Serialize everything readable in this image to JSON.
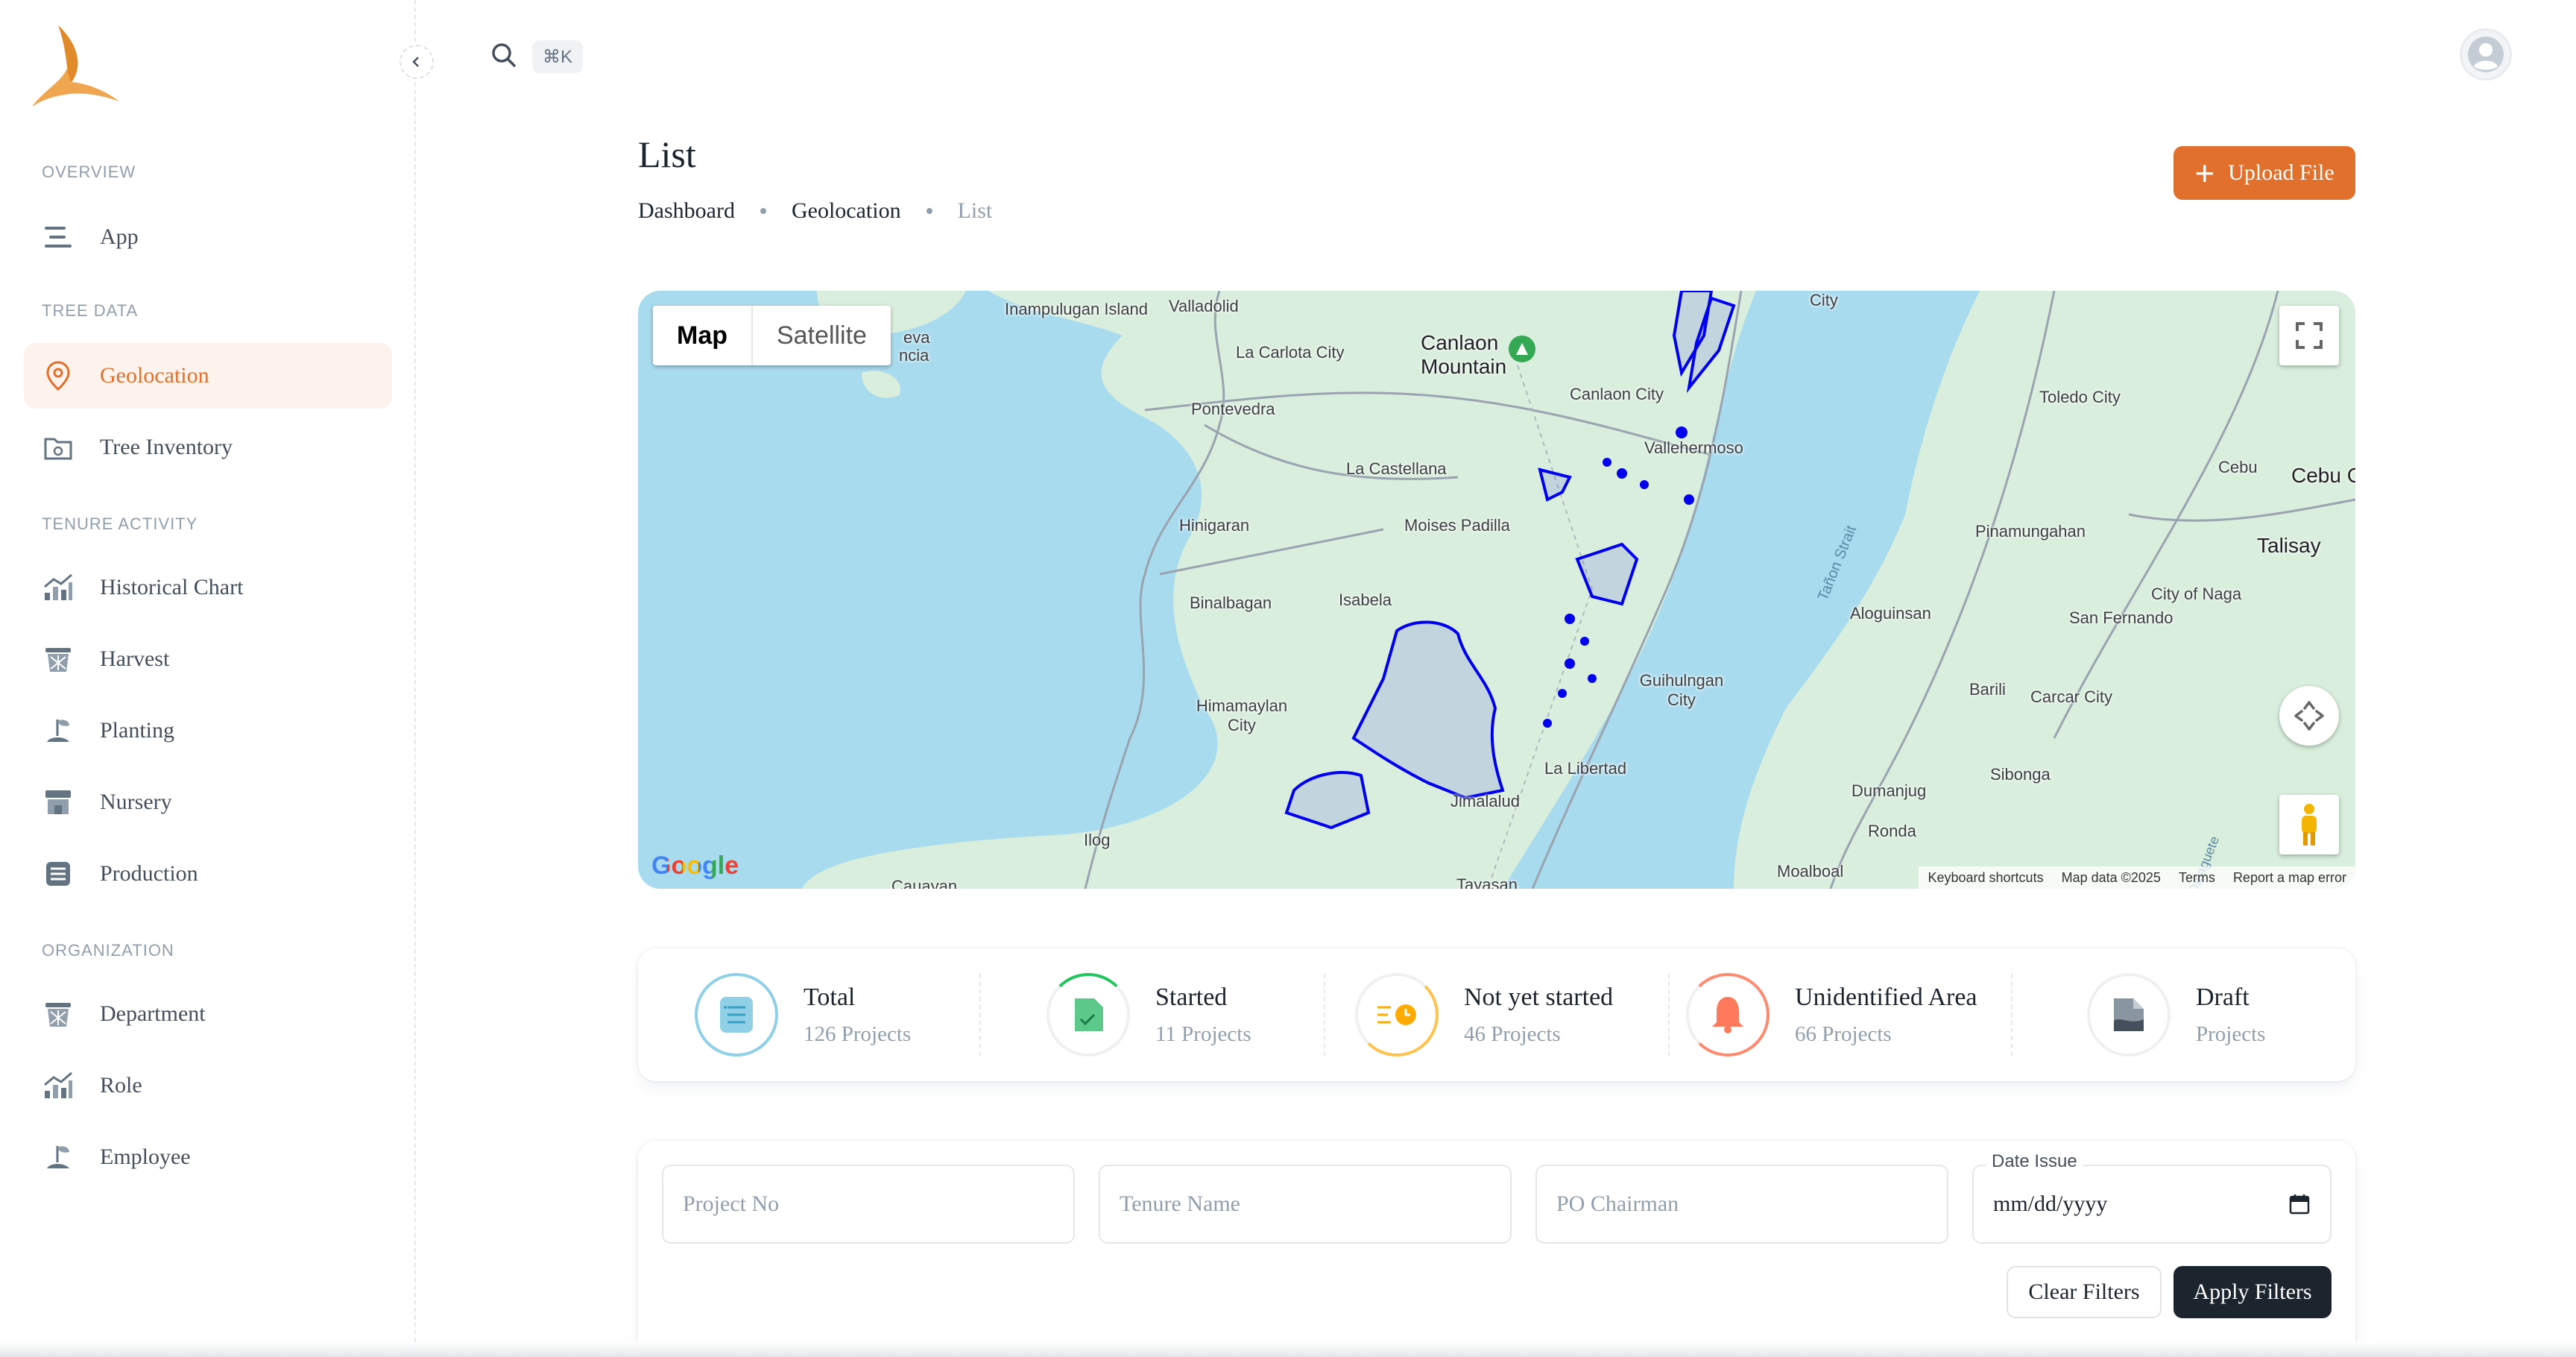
{
  "colors": {
    "accent": "#e0702c",
    "dark": "#1c252e",
    "muted": "#919eab",
    "map_water": "#a9dbee",
    "map_land": "#d9eedc",
    "polygon": "#0000ff"
  },
  "sidebar": {
    "sections": [
      {
        "label": "OVERVIEW"
      },
      {
        "label": "TREE DATA"
      },
      {
        "label": "TENURE ACTIVITY"
      },
      {
        "label": "ORGANIZATION"
      }
    ],
    "items": [
      {
        "label": "App",
        "icon": "menu-lines-icon"
      },
      {
        "label": "Geolocation",
        "icon": "map-pin-icon",
        "active": true
      },
      {
        "label": "Tree Inventory",
        "icon": "folder-tree-icon"
      },
      {
        "label": "Historical Chart",
        "icon": "chart-icon"
      },
      {
        "label": "Harvest",
        "icon": "basket-icon"
      },
      {
        "label": "Planting",
        "icon": "plant-icon"
      },
      {
        "label": "Nursery",
        "icon": "store-icon"
      },
      {
        "label": "Production",
        "icon": "list-box-icon"
      },
      {
        "label": "Department",
        "icon": "basket-icon"
      },
      {
        "label": "Role",
        "icon": "chart-icon"
      },
      {
        "label": "Employee",
        "icon": "plant-icon"
      }
    ]
  },
  "header": {
    "shortcut": "⌘K"
  },
  "page": {
    "title": "List",
    "breadcrumb": [
      "Dashboard",
      "Geolocation",
      "List"
    ],
    "upload_label": "Upload File"
  },
  "map": {
    "toggle": [
      "Map",
      "Satellite"
    ],
    "labels": [
      "Inampulugan Island",
      "Valladolid",
      "La Carlota City",
      "Canlaon Mountain",
      "Canlaon City",
      "Pontevedra",
      "Vallehermoso",
      "La Castellana",
      "Hinigaran",
      "Moises Padilla",
      "Binalbagan",
      "Isabela",
      "Himamaylan City",
      "Guihulngan City",
      "La Libertad",
      "Jimalalud",
      "Ilog",
      "Cauayan",
      "Tayasan",
      "Moalboal",
      "Toledo City",
      "Cebu",
      "Cebu C",
      "Talisay",
      "Pinamungahan",
      "City of Naga",
      "Aloguinsan",
      "San Fernando",
      "Barili",
      "Carcar City",
      "Sibonga",
      "Dumanjug",
      "Ronda",
      "Tañon Strait",
      "City",
      "eva",
      "ncia",
      "Dalaguete"
    ],
    "google": "Google",
    "attribution": [
      "Keyboard shortcuts",
      "Map data ©2025",
      "Terms",
      "Report a map error"
    ]
  },
  "stats": [
    {
      "name": "Total",
      "sub": "126 Projects",
      "icon": "list-icon",
      "progress": 1.0,
      "color": "#4aa6c9"
    },
    {
      "name": "Started",
      "sub": "11 Projects",
      "icon": "document-check-icon",
      "progress": 0.09,
      "color": "#22c55e"
    },
    {
      "name": "Not yet started",
      "sub": "46 Projects",
      "icon": "clock-lines-icon",
      "progress": 0.37,
      "color": "#ffab00"
    },
    {
      "name": "Unidentified Area",
      "sub": "66 Projects",
      "icon": "bell-icon",
      "progress": 0.52,
      "color": "#ff5630"
    },
    {
      "name": "Draft",
      "sub": "Projects",
      "icon": "draft-file-icon",
      "progress": 0.0,
      "color": "#637381"
    }
  ],
  "filters": {
    "project_no_placeholder": "Project No",
    "tenure_name_placeholder": "Tenure Name",
    "po_chairman_placeholder": "PO Chairman",
    "date_label": "Date Issue",
    "date_value": "mm/dd/yyyy",
    "clear_label": "Clear Filters",
    "apply_label": "Apply Filters"
  }
}
